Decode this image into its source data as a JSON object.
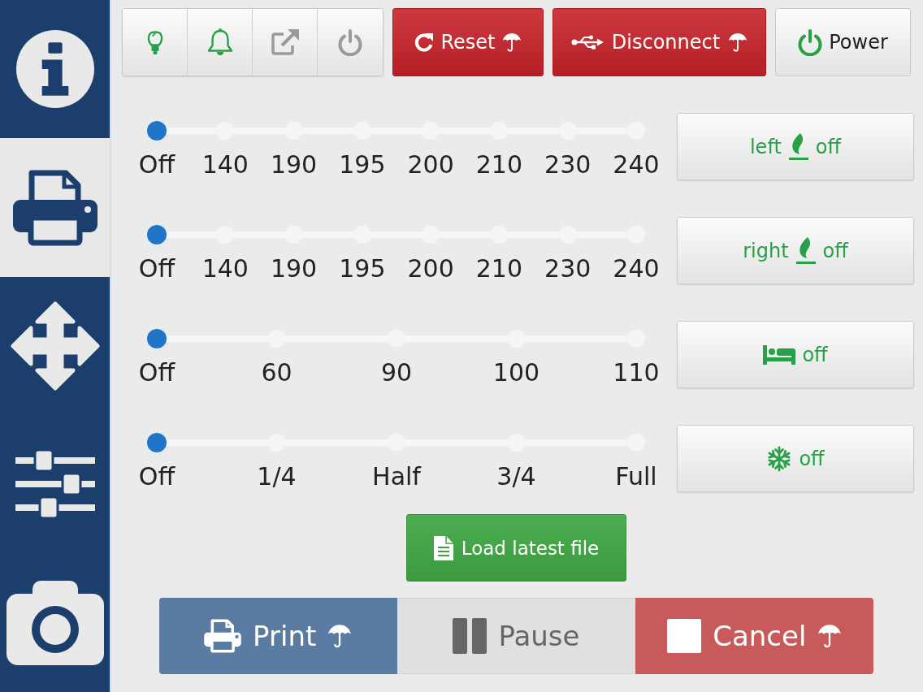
{
  "sidebar": {
    "items": [
      {
        "kind": "info",
        "selected": false
      },
      {
        "kind": "print",
        "selected": true
      },
      {
        "kind": "move",
        "selected": false
      },
      {
        "kind": "settings",
        "selected": false
      },
      {
        "kind": "camera",
        "selected": false
      }
    ]
  },
  "toolbar": {
    "toggles": [
      {
        "kind": "light",
        "on": true
      },
      {
        "kind": "bell",
        "on": true
      },
      {
        "kind": "external",
        "on": false
      },
      {
        "kind": "power",
        "on": false
      }
    ],
    "actions": [
      {
        "kind": "reset",
        "label": "Reset",
        "confirm": true
      },
      {
        "kind": "disconnect",
        "label": "Disconnect",
        "confirm": true
      },
      {
        "kind": "power",
        "label": "Power",
        "confirm": false
      }
    ]
  },
  "controls": [
    {
      "stops": [
        "Off",
        "140",
        "190",
        "195",
        "200",
        "210",
        "230",
        "240"
      ],
      "level": 0,
      "button": {
        "kind": "hotend",
        "label": "left",
        "status": "off"
      }
    },
    {
      "stops": [
        "Off",
        "140",
        "190",
        "195",
        "200",
        "210",
        "230",
        "240"
      ],
      "level": 0,
      "button": {
        "kind": "hotend",
        "label": "right",
        "status": "off"
      }
    },
    {
      "stops": [
        "Off",
        "60",
        "90",
        "100",
        "110"
      ],
      "level": 0,
      "button": {
        "kind": "bed",
        "status": "off"
      }
    },
    {
      "stops": [
        "Off",
        "1/4",
        "Half",
        "3/4",
        "Full"
      ],
      "level": 0,
      "button": {
        "kind": "fan",
        "status": "off"
      }
    }
  ],
  "load_button": {
    "label": "Load latest file"
  },
  "job_controls": [
    {
      "kind": "print",
      "label": "Print",
      "confirm": true
    },
    {
      "kind": "pause",
      "label": "Pause",
      "confirm": false
    },
    {
      "kind": "cancel",
      "label": "Cancel",
      "confirm": true
    }
  ]
}
